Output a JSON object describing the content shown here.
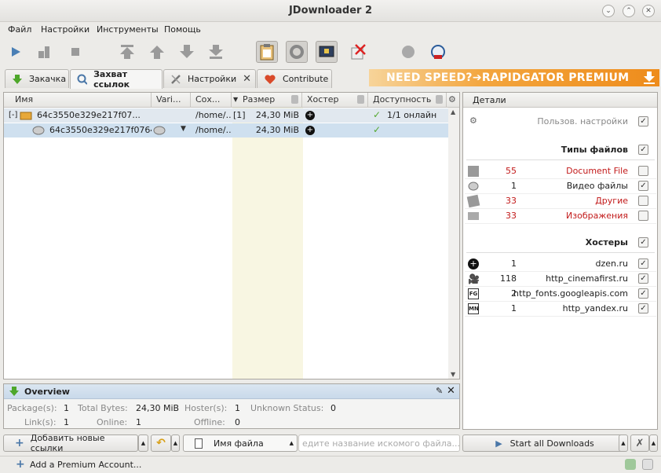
{
  "window": {
    "title": "JDownloader 2"
  },
  "menu": [
    "Файл",
    "Настройки",
    "Инструменты",
    "Помощь"
  ],
  "tabs": {
    "download": "Закачка",
    "linkgrabber": "Захват ссылок",
    "settings": "Настройки",
    "contribute": "Contribute"
  },
  "banner": "NEED SPEED?➔RAPIDGATOR PREMIUM",
  "table": {
    "columns": [
      "Имя",
      "Vari...",
      "Сох...",
      "Размер",
      "Хостер",
      "Доступность"
    ],
    "rows": [
      {
        "toggle": "[-]",
        "name": "64c3550e329e217f07...",
        "save": "/home/...",
        "count": "[1]",
        "size": "24,30 MiB",
        "avail": "1/1 онлайн"
      },
      {
        "name": "64c3550e329e217f0764a...",
        "save": "/home/...",
        "size": "24,30 MiB"
      }
    ]
  },
  "details": {
    "title": "Детали",
    "custom": "Пользов. настройки",
    "filetypes_title": "Типы файлов",
    "filetypes": [
      {
        "count": "55",
        "label": "Document File",
        "red": true,
        "checked": false
      },
      {
        "count": "1",
        "label": "Видео файлы",
        "red": false,
        "checked": true
      },
      {
        "count": "33",
        "label": "Другие",
        "red": true,
        "checked": false
      },
      {
        "count": "33",
        "label": "Изображения",
        "red": true,
        "checked": false
      }
    ],
    "hosters_title": "Хостеры",
    "hosters": [
      {
        "count": "1",
        "label": "dzen.ru",
        "checked": true
      },
      {
        "count": "118",
        "label": "http_cinemafirst.ru",
        "checked": true
      },
      {
        "count": "2",
        "label": "http_fonts.googleapis.com",
        "checked": true
      },
      {
        "count": "1",
        "label": "http_yandex.ru",
        "checked": true
      }
    ]
  },
  "overview": {
    "title": "Overview",
    "packages_label": "Package(s):",
    "packages": "1",
    "bytes_label": "Total Bytes:",
    "bytes": "24,30 MiB",
    "hosters_label": "Hoster(s):",
    "hosters": "1",
    "unknown_label": "Unknown Status:",
    "unknown": "0",
    "links_label": "Link(s):",
    "links": "1",
    "online_label": "Online:",
    "online": "1",
    "offline_label": "Offline:",
    "offline": "0"
  },
  "bottom": {
    "add_links": "Добавить новые ссылки",
    "filename_select": "Имя файла",
    "search_placeholder": "едите название искомого файла...",
    "start_all": "Start all Downloads",
    "premium": "Add a Premium Account..."
  }
}
